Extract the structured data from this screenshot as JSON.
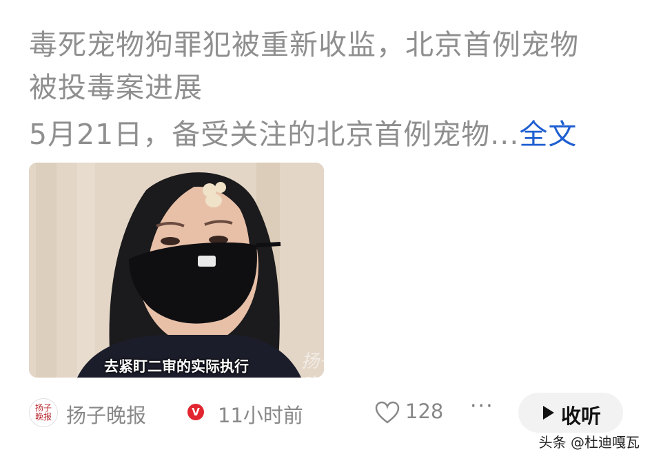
{
  "article": {
    "title_line1": "毒死宠物狗罪犯被重新收监，北京首例宠物",
    "title_line2": "被投毒案进展",
    "summary": "5月21日，备受关注的北京首例宠物...",
    "more_label": "全文"
  },
  "thumbnail": {
    "subtitle": "去紧盯二审的实际执行",
    "watermark": "扬子晚报"
  },
  "footer": {
    "avatar_text": "扬子晚报",
    "source_name": "扬子晚报",
    "verified_mark": "V",
    "time_ago": "11小时前",
    "like_count": "128",
    "more_icon": "···",
    "listen_label": "收听"
  },
  "credit": "头条 @杜迪嘎瓦",
  "colors": {
    "title_gray": "#8f8f8f",
    "link_blue": "#1f5fd1",
    "verified_red": "#e2262f"
  }
}
